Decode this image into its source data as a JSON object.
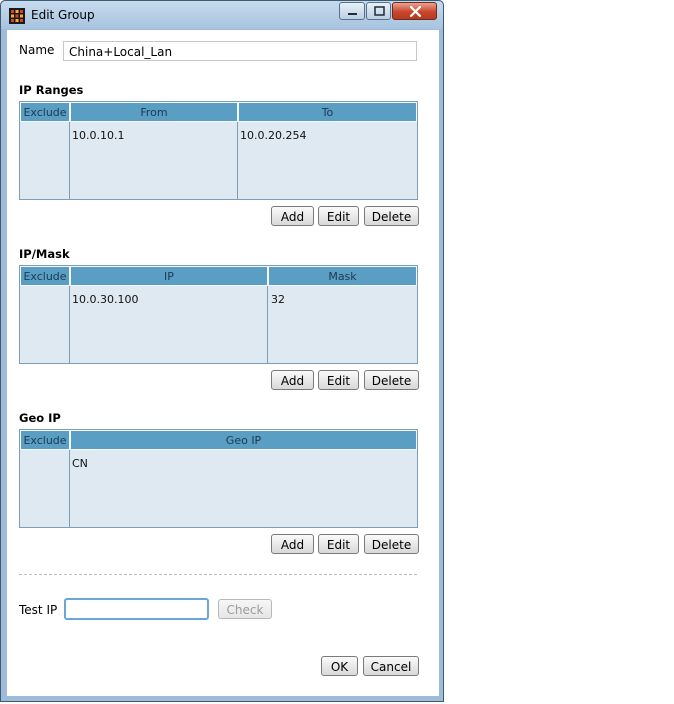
{
  "window": {
    "title": "Edit Group",
    "close_color": "#c9462c",
    "accent_color": "#5b9ec4"
  },
  "name": {
    "label": "Name",
    "value": "China+Local_Lan"
  },
  "ip_ranges": {
    "title": "IP Ranges",
    "columns": [
      "Exclude",
      "From",
      "To"
    ],
    "rows": [
      {
        "exclude": "",
        "from": "10.0.10.1",
        "to": "10.0.20.254"
      }
    ],
    "buttons": {
      "add": "Add",
      "edit": "Edit",
      "delete": "Delete"
    }
  },
  "ip_mask": {
    "title": "IP/Mask",
    "columns": [
      "Exclude",
      "IP",
      "Mask"
    ],
    "rows": [
      {
        "exclude": "",
        "ip": "10.0.30.100",
        "mask": "32"
      }
    ],
    "buttons": {
      "add": "Add",
      "edit": "Edit",
      "delete": "Delete"
    }
  },
  "geo_ip": {
    "title": "Geo IP",
    "columns": [
      "Exclude",
      "Geo IP"
    ],
    "rows": [
      {
        "exclude": "",
        "geo": "CN"
      }
    ],
    "buttons": {
      "add": "Add",
      "edit": "Edit",
      "delete": "Delete"
    }
  },
  "test_ip": {
    "label": "Test IP",
    "value": "",
    "check_label": "Check"
  },
  "footer": {
    "ok": "OK",
    "cancel": "Cancel"
  }
}
